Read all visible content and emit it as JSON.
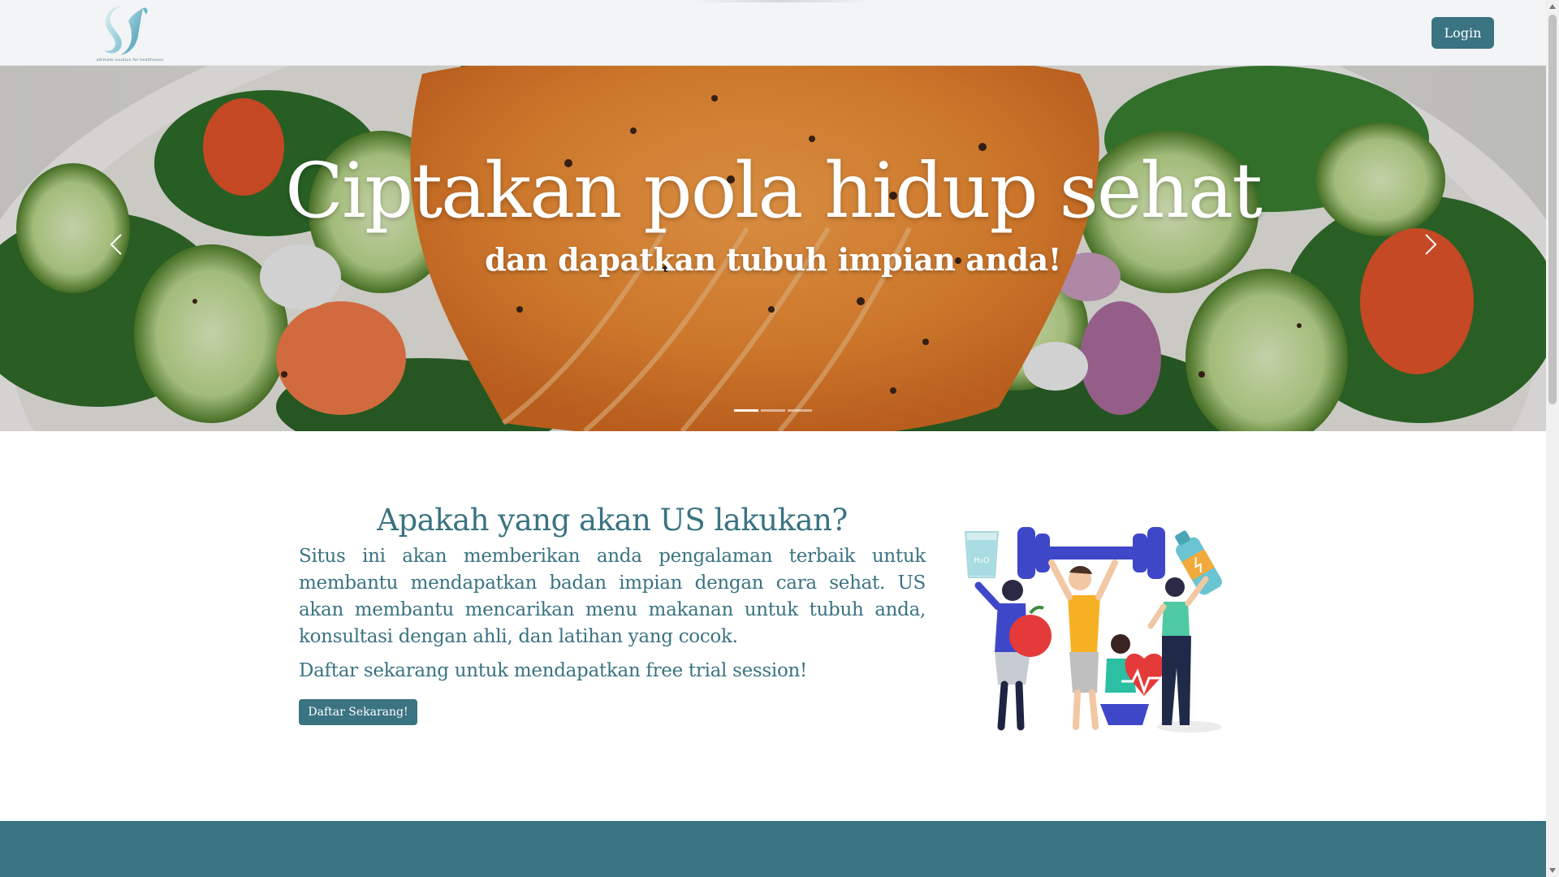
{
  "navbar": {
    "logo_tagline": "ultimate solution for healthiness",
    "login_label": "Login"
  },
  "hero": {
    "title": "Ciptakan pola hidup sehat",
    "subtitle": "dan dapatkan tubuh impian anda!",
    "slide_count": 3,
    "active_slide": 1,
    "prev_icon": "chevron-left-icon",
    "next_icon": "chevron-right-icon"
  },
  "about": {
    "title": "Apakah yang akan US lakukan?",
    "body": "Situs ini akan memberikan anda pengalaman terbaik untuk membantu mendapatkan badan impian dengan cara sehat. US akan membantu mencarikan menu makanan untuk tubuh anda, konsultasi dengan ahli, dan latihan yang cocok.",
    "cta_text": "Daftar sekarang untuk mendapatkan free trial session!",
    "signup_label": "Daftar Sekarang!",
    "illustration_water_label": "H₂O"
  },
  "colors": {
    "brand": "#3a7382",
    "navbar_bg": "#f3f4f6",
    "text": "#3a7382",
    "button_text": "#ffffff"
  }
}
